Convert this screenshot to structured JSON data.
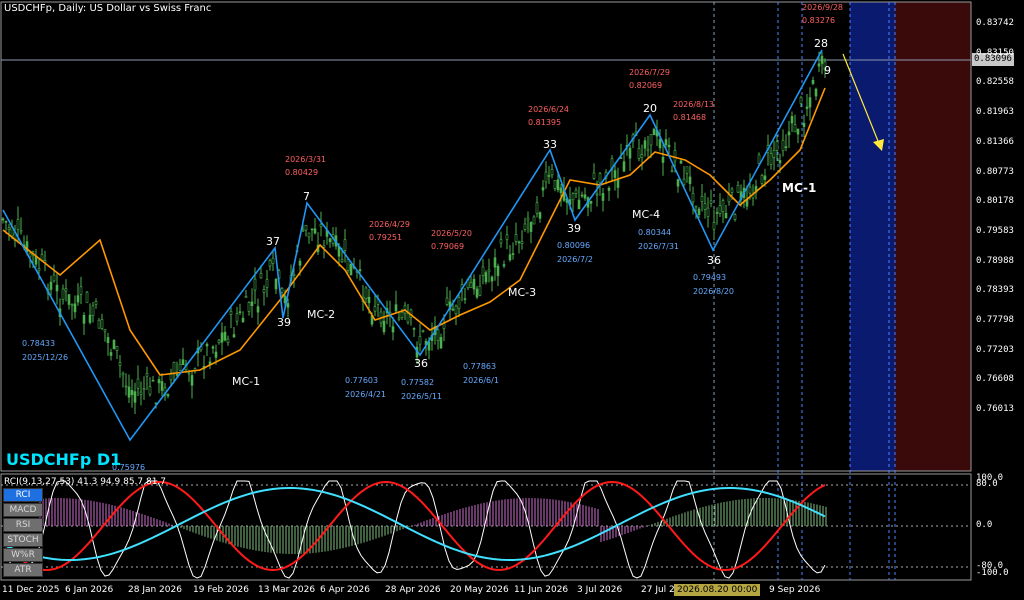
{
  "chart": {
    "title": "USDCHFp, Daily:  US Dollar vs Swiss Franc",
    "symbol_label": "USDCHFp D1",
    "current_price": "0.83096",
    "crosshair_date": "2026.08.20 00:00",
    "colors": {
      "candle": "#4caf50",
      "ma": "#ff9800",
      "zigzag": "#2196f3",
      "zone1": "#0a1a6e",
      "zone2": "#3a0909"
    }
  },
  "price_axis": [
    "0.83742",
    "0.83150",
    "0.82558",
    "0.81963",
    "0.81366",
    "0.80773",
    "0.80178",
    "0.79583",
    "0.78988",
    "0.78393",
    "0.77798",
    "0.77203",
    "0.76608",
    "0.76013"
  ],
  "time_axis": [
    "11 Dec 2025",
    "6 Jan 2026",
    "28 Jan 2026",
    "19 Feb 2026",
    "13 Mar 2026",
    "6 Apr 2026",
    "28 Apr 2026",
    "20 May 2026",
    "11 Jun 2026",
    "3 Jul 2026",
    "27 Jul 2026",
    "6",
    "9 Sep 2026"
  ],
  "wave_labels": [
    "37",
    "39",
    "7",
    "36",
    "33",
    "39",
    "20",
    "36",
    "28",
    "9",
    "MC-1",
    "MC-2",
    "MC-3",
    "MC-4",
    "MC-1"
  ],
  "pivot_annotations": [
    {
      "date": "2025/12/26",
      "price": "0.78433"
    },
    {
      "date": "",
      "price": "0.75976"
    },
    {
      "date": "2026/3/31",
      "price": "0.80429"
    },
    {
      "date": "2026/4/21",
      "price": "0.77603"
    },
    {
      "date": "2026/4/29",
      "price": "0.79251"
    },
    {
      "date": "2026/5/11",
      "price": "0.77582"
    },
    {
      "date": "2026/5/20",
      "price": "0.79069"
    },
    {
      "date": "2026/6/1",
      "price": "0.77863"
    },
    {
      "date": "2026/6/24",
      "price": "0.81395"
    },
    {
      "date": "2026/7/2",
      "price": "0.80096"
    },
    {
      "date": "2026/7/29",
      "price": "0.82069"
    },
    {
      "date": "2026/7/31",
      "price": "0.80344"
    },
    {
      "date": "2026/8/13",
      "price": "0.81468"
    },
    {
      "date": "2026/8/20",
      "price": "0.79493"
    },
    {
      "date": "2026/9/28",
      "price": "0.83276"
    }
  ],
  "indicator": {
    "label": "RCI(9,13,27,53) 41.3 94.9 85.7 81.7",
    "axis": [
      "100.0",
      "80.0",
      "0.0",
      "-80.0",
      "-100.0"
    ],
    "tabs": [
      "RCI",
      "MACD",
      "RSI",
      "STOCH",
      "W%R",
      "ATR"
    ],
    "active_tab": "RCI"
  }
}
